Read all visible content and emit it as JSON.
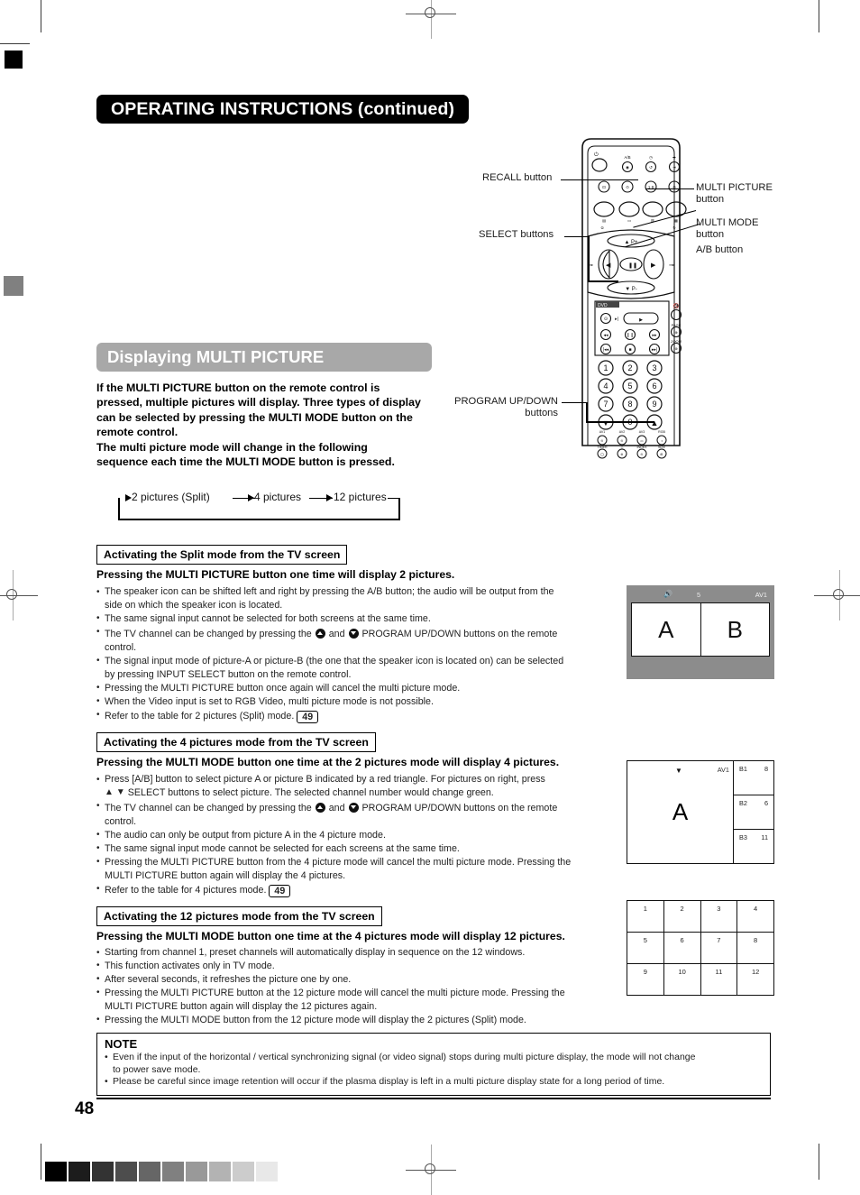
{
  "page": {
    "header_title": "OPERATING INSTRUCTIONS (continued)",
    "page_number": "48"
  },
  "remote": {
    "callouts": [
      {
        "id": "recall",
        "label": "RECALL button"
      },
      {
        "id": "select",
        "label": "SELECT buttons"
      },
      {
        "id": "program",
        "label_line1": "PROGRAM UP/DOWN",
        "label_line2": "buttons"
      },
      {
        "id": "multi-picture",
        "label_line1": "MULTI PICTURE",
        "label_line2": "button"
      },
      {
        "id": "multi-mode",
        "label_line1": "MULTI MODE",
        "label_line2": "button"
      },
      {
        "id": "ab",
        "label": "A/B button"
      }
    ],
    "keypad": [
      "1",
      "2",
      "3",
      "4",
      "5",
      "6",
      "7",
      "8",
      "9",
      "0"
    ],
    "dvd_label": "DVD"
  },
  "section": {
    "title": "Displaying MULTI PICTURE",
    "title_bg": "#a8a8a8",
    "intro": "If the MULTI PICTURE button on the remote control is pressed, multiple pictures will display. Three types of display can be selected by pressing the MULTI MODE button on the remote control.\nThe multi picture mode will change in the following sequence each time the MULTI MODE button is pressed."
  },
  "sequence": {
    "steps": [
      "2 pictures (Split)",
      "4 pictures",
      "12 pictures"
    ]
  },
  "split_section": {
    "heading": "Activating the Split mode from the TV screen",
    "lead": "Pressing the MULTI PICTURE button one time will display 2 pictures.",
    "bullets": [
      "The speaker icon can be shifted left and right by pressing the A/B button; the audio will be output from the",
      "side on which the speaker icon is located.",
      "The same signal input cannot be selected for both screens at the same time.",
      "The TV channel can be changed by pressing the @UP@ and @DN@ PROGRAM UP/DOWN buttons on the remote",
      "control.",
      "The signal input mode of picture-A or picture-B (the one that the speaker icon is located on) can be selected",
      "by pressing INPUT SELECT button on the remote control.",
      "Pressing the MULTI PICTURE button once again will cancel the multi picture mode.",
      "When the Video input is set to RGB Video, multi picture mode is not possible.",
      "Refer to the table for 2 pictures (Split) mode."
    ],
    "page_ref": "49"
  },
  "four_section": {
    "heading": "Activating the 4 pictures mode from the TV screen",
    "lead": "Pressing the MULTI MODE button one time at the 2 pictures mode will display 4 pictures.",
    "bullets": [
      "Press [A/B] button to select  picture A or picture B  indicated by a red triangle. For pictures on right, press",
      "@UPT@ @DNT@ SELECT buttons to select picture. The selected channel number would change green.",
      "The TV channel can be changed by pressing the @UP@ and @DN@ PROGRAM UP/DOWN buttons on the remote",
      "control.",
      "The audio can only be output from picture A in the 4 picture mode.",
      "The same signal input mode cannot be selected for each screens at the same time.",
      "Pressing the MULTI PICTURE button from the 4 picture mode will cancel the multi picture mode. Pressing the",
      "MULTI PICTURE button again will display the 4 pictures.",
      "Refer to the table for 4 pictures mode."
    ],
    "page_ref": "49"
  },
  "twelve_section": {
    "heading": "Activating the 12 pictures mode from the TV screen",
    "lead": "Pressing the MULTI MODE button one time at the 4 pictures mode will display 12 pictures.",
    "bullets": [
      "Starting from channel 1, preset channels will automatically display in sequence on the 12 windows.",
      "This function activates only in TV mode.",
      "After several seconds, it refreshes the picture one by one.",
      "Pressing the MULTI PICTURE button at the 12 picture mode will cancel the multi picture mode. Pressing the",
      "MULTI PICTURE button again will display the 12 pictures again.",
      "Pressing the MULTI MODE button from the 12 picture mode will display the 2 pictures (Split) mode."
    ]
  },
  "screen_split": {
    "speaker_icon": "speaker-icon",
    "channel": "5",
    "input": "AV1",
    "pane_a": "A",
    "pane_b": "B"
  },
  "screen_four": {
    "marker": "▼",
    "input": "AV1",
    "pane_a": "A",
    "subpanes": [
      {
        "name": "B1",
        "channel": "8"
      },
      {
        "name": "B2",
        "channel": "6"
      },
      {
        "name": "B3",
        "channel": "11"
      }
    ]
  },
  "screen_twelve": {
    "cells": [
      "1",
      "2",
      "3",
      "4",
      "5",
      "6",
      "7",
      "8",
      "9",
      "10",
      "11",
      "12"
    ]
  },
  "note": {
    "heading": "NOTE",
    "bullets": [
      "Even if the input of the horizontal / vertical synchronizing signal (or video signal) stops during multi picture display, the mode will not change",
      "to power save mode.",
      "Please be careful since image retention will occur if the plasma display is left in a multi picture display state for a long period of time."
    ]
  },
  "grayscale_strip": [
    "#000000",
    "#1c1c1c",
    "#333333",
    "#4d4d4d",
    "#666666",
    "#808080",
    "#999999",
    "#b3b3b3",
    "#cccccc",
    "#e8e8e8"
  ]
}
